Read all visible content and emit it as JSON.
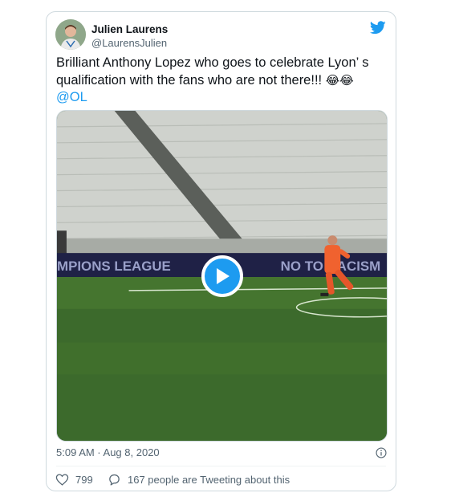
{
  "author": {
    "name": "Julien Laurens",
    "handle": "@LaurensJulien"
  },
  "tweet": {
    "text": "Brilliant Anthony Lopez who goes to celebrate Lyon’ s qualification with the fans who are not there!!!",
    "emojis": "😂😂",
    "mention": "@OL"
  },
  "media": {
    "type": "video",
    "play_icon": "play-icon",
    "banner_left_text": "MPIONS LEAGUE",
    "banner_right_text": "NO TO RACISM"
  },
  "meta": {
    "timestamp": "5:09 AM · Aug 8, 2020"
  },
  "actions": {
    "likes": "799",
    "conversation": "167 people are Tweeting about this"
  },
  "colors": {
    "accent": "#1d9bf0",
    "secondary_text": "#536471",
    "border": "#cfd9de"
  }
}
